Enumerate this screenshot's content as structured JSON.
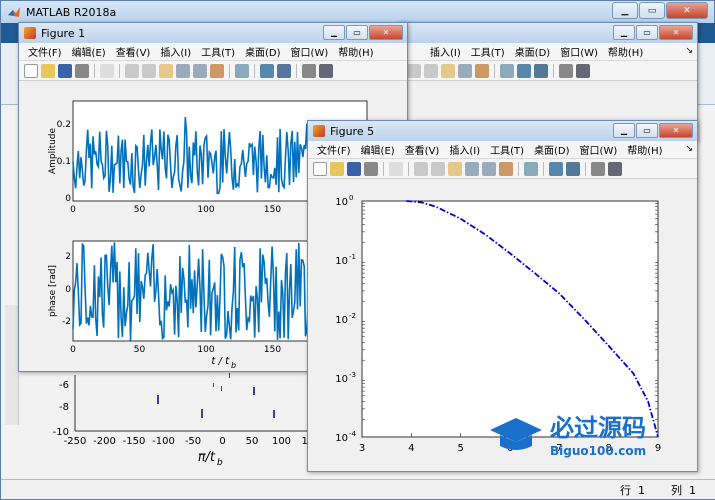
{
  "main_window": {
    "title": "MATLAB R2018a",
    "status": {
      "row_label": "行",
      "row_value": "1",
      "col_label": "列",
      "col_value": "1"
    },
    "background_plot": {
      "y_ticks": [
        "-6",
        "-8",
        "-10"
      ],
      "x_ticks": [
        "-250",
        "-200",
        "-150",
        "-100",
        "-50",
        "0",
        "50",
        "100",
        "150"
      ],
      "xlabel_main": "π/t",
      "xlabel_sub": "b"
    }
  },
  "figure1": {
    "title": "Figure 1",
    "menu": [
      "文件(F)",
      "编辑(E)",
      "查看(V)",
      "插入(I)",
      "工具(T)",
      "桌面(D)",
      "窗口(W)",
      "帮助(H)"
    ],
    "top_plot": {
      "ylabel": "Amplitude",
      "y_ticks": [
        "0.2",
        "0.1",
        "0"
      ],
      "x_ticks": [
        "0",
        "50",
        "100",
        "150",
        "200"
      ]
    },
    "bottom_plot": {
      "ylabel": "phase [rad]",
      "y_ticks": [
        "2",
        "0",
        "-2"
      ],
      "x_ticks": [
        "0",
        "50",
        "100",
        "150",
        "200"
      ],
      "xlabel_main": "t / t",
      "xlabel_sub": "b"
    }
  },
  "figure2_partial": {
    "menu": [
      "插入(I)",
      "工具(T)",
      "桌面(D)",
      "窗口(W)",
      "帮助(H)"
    ]
  },
  "figure5": {
    "title": "Figure 5",
    "menu": [
      "文件(F)",
      "编辑(E)",
      "查看(V)",
      "插入(I)",
      "工具(T)",
      "桌面(D)",
      "窗口(W)",
      "帮助(H)"
    ],
    "chart_data": {
      "type": "line",
      "title": "",
      "xlabel": "",
      "ylabel": "",
      "y_scale": "log",
      "xlim": [
        3,
        9
      ],
      "ylim": [
        0.0001,
        1
      ],
      "x_ticks": [
        "3",
        "4",
        "5",
        "6",
        "7",
        "8",
        "9"
      ],
      "y_ticks": [
        "10^0",
        "10^-1",
        "10^-2",
        "10^-3",
        "10^-4"
      ],
      "series": [
        {
          "line_style": "dash-dot",
          "color": "#0000cc",
          "x": [
            3.9,
            4.2,
            4.5,
            5.0,
            5.5,
            6.0,
            6.5,
            7.0,
            7.5,
            8.0,
            8.5,
            8.8,
            9.0
          ],
          "y": [
            1.0,
            0.95,
            0.8,
            0.5,
            0.27,
            0.13,
            0.06,
            0.027,
            0.01,
            0.0035,
            0.0012,
            0.0004,
            0.0001
          ]
        }
      ]
    }
  },
  "watermark": {
    "title": "必过源码",
    "subtitle": "Biguo100.com"
  }
}
